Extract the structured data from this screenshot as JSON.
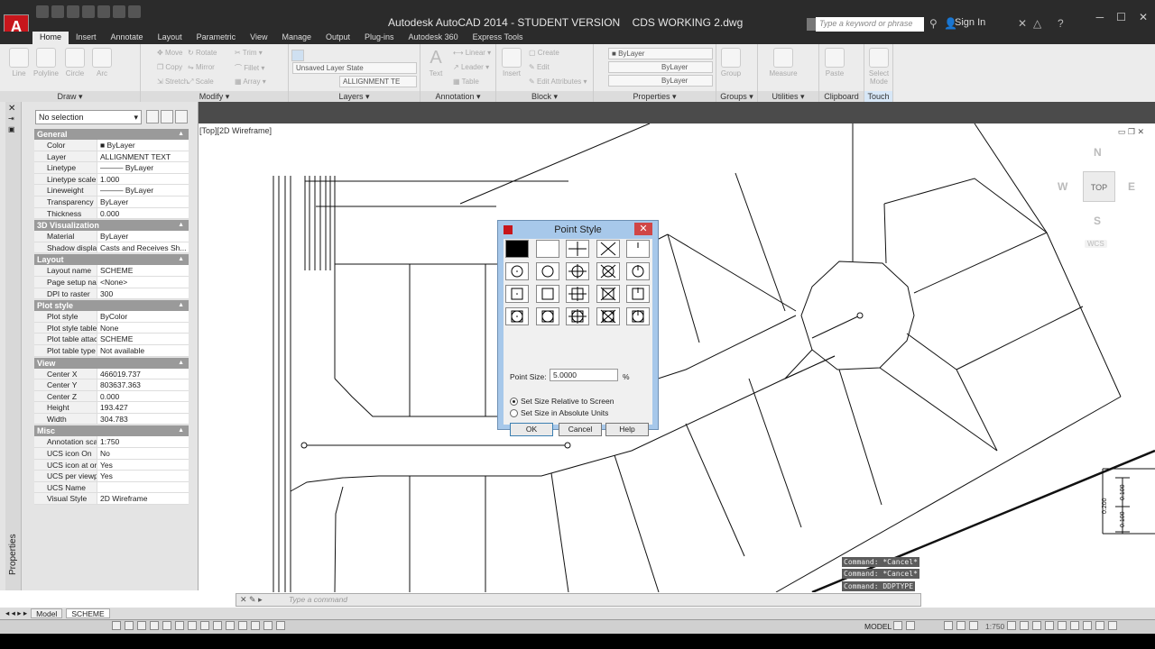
{
  "titlebar": {
    "app": "Autodesk AutoCAD 2014 - STUDENT VERSION",
    "file": "CDS WORKING 2.dwg",
    "search_placeholder": "Type a keyword or phrase",
    "signin": "Sign In",
    "logo": "A"
  },
  "tabs": [
    "Home",
    "Insert",
    "Annotate",
    "Layout",
    "Parametric",
    "View",
    "Manage",
    "Output",
    "Plug-ins",
    "Autodesk 360",
    "Express Tools"
  ],
  "ribbon": {
    "draw": {
      "label": "Draw",
      "tools": [
        "Line",
        "Polyline",
        "Circle",
        "Arc"
      ]
    },
    "modify": {
      "label": "Modify",
      "tools": [
        "Move",
        "Rotate",
        "Trim",
        "Copy",
        "Mirror",
        "Fillet",
        "Stretch",
        "Scale",
        "Array"
      ]
    },
    "layers": {
      "label": "Layers",
      "layer_state": "Unsaved Layer State",
      "current": "ALLIGNMENT TE"
    },
    "annotation": {
      "label": "Annotation",
      "text": "Text",
      "linear": "Linear",
      "leader": "Leader",
      "table": "Table"
    },
    "block": {
      "label": "Block",
      "insert": "Insert",
      "create": "Create",
      "edit": "Edit",
      "edit_attributes": "Edit Attributes"
    },
    "properties": {
      "label": "Properties",
      "color": "ByLayer",
      "linetype": "ByLayer",
      "lineweight": "ByLayer"
    },
    "groups": {
      "label": "Groups",
      "group": "Group"
    },
    "utilities": {
      "label": "Utilities",
      "measure": "Measure"
    },
    "clipboard": {
      "label": "Clipboard",
      "paste": "Paste"
    },
    "touch": {
      "label": "Touch",
      "select_mode": "Select Mode"
    }
  },
  "properties_palette": {
    "selection": "No selection",
    "strip_label": "Properties",
    "sections": [
      {
        "title": "General",
        "rows": [
          [
            "Color",
            "■ ByLayer"
          ],
          [
            "Layer",
            "ALLIGNMENT TEXT"
          ],
          [
            "Linetype",
            "——— ByLayer"
          ],
          [
            "Linetype scale",
            "1.000"
          ],
          [
            "Lineweight",
            "——— ByLayer"
          ],
          [
            "Transparency",
            "ByLayer"
          ],
          [
            "Thickness",
            "0.000"
          ]
        ]
      },
      {
        "title": "3D Visualization",
        "rows": [
          [
            "Material",
            "ByLayer"
          ],
          [
            "Shadow display",
            "Casts and Receives Sh..."
          ]
        ]
      },
      {
        "title": "Layout",
        "rows": [
          [
            "Layout name",
            "SCHEME"
          ],
          [
            "Page setup name",
            "<None>"
          ],
          [
            "DPI to raster",
            "300"
          ]
        ]
      },
      {
        "title": "Plot style",
        "rows": [
          [
            "Plot style",
            "ByColor"
          ],
          [
            "Plot style table",
            "None"
          ],
          [
            "Plot table attache...",
            "SCHEME"
          ],
          [
            "Plot table type",
            "Not available"
          ]
        ]
      },
      {
        "title": "View",
        "rows": [
          [
            "Center X",
            "466019.737"
          ],
          [
            "Center Y",
            "803637.363"
          ],
          [
            "Center Z",
            "0.000"
          ],
          [
            "Height",
            "193.427"
          ],
          [
            "Width",
            "304.783"
          ]
        ]
      },
      {
        "title": "Misc",
        "rows": [
          [
            "Annotation scale",
            "1:750"
          ],
          [
            "UCS icon On",
            "No"
          ],
          [
            "UCS icon at origin",
            "Yes"
          ],
          [
            "UCS per viewport",
            "Yes"
          ],
          [
            "UCS Name",
            ""
          ],
          [
            "Visual Style",
            "2D Wireframe"
          ]
        ]
      }
    ]
  },
  "viewport": {
    "label": "[Top][2D Wireframe]",
    "navcube": {
      "n": "N",
      "s": "S",
      "e": "E",
      "w": "W",
      "top": "TOP",
      "wcs": "WCS"
    }
  },
  "dialog": {
    "title": "Point Style",
    "point_size_label": "Point Size:",
    "point_size_value": "5.0000",
    "percent": "%",
    "radio_relative": "Set Size Relative to Screen",
    "radio_absolute": "Set Size in Absolute Units",
    "ok": "OK",
    "cancel": "Cancel",
    "help": "Help",
    "selected_index": 0
  },
  "dimension_text": {
    "a": "0.200",
    "b": "0.100",
    "c": "0.100"
  },
  "command": {
    "history": [
      "Command: *Cancel*",
      "Command: *Cancel*",
      "Command: DDPTYPE"
    ],
    "placeholder": "Type a command"
  },
  "layout_tabs": [
    "Model",
    "SCHEME"
  ],
  "status": {
    "space": "MODEL",
    "scale": "1:750"
  }
}
